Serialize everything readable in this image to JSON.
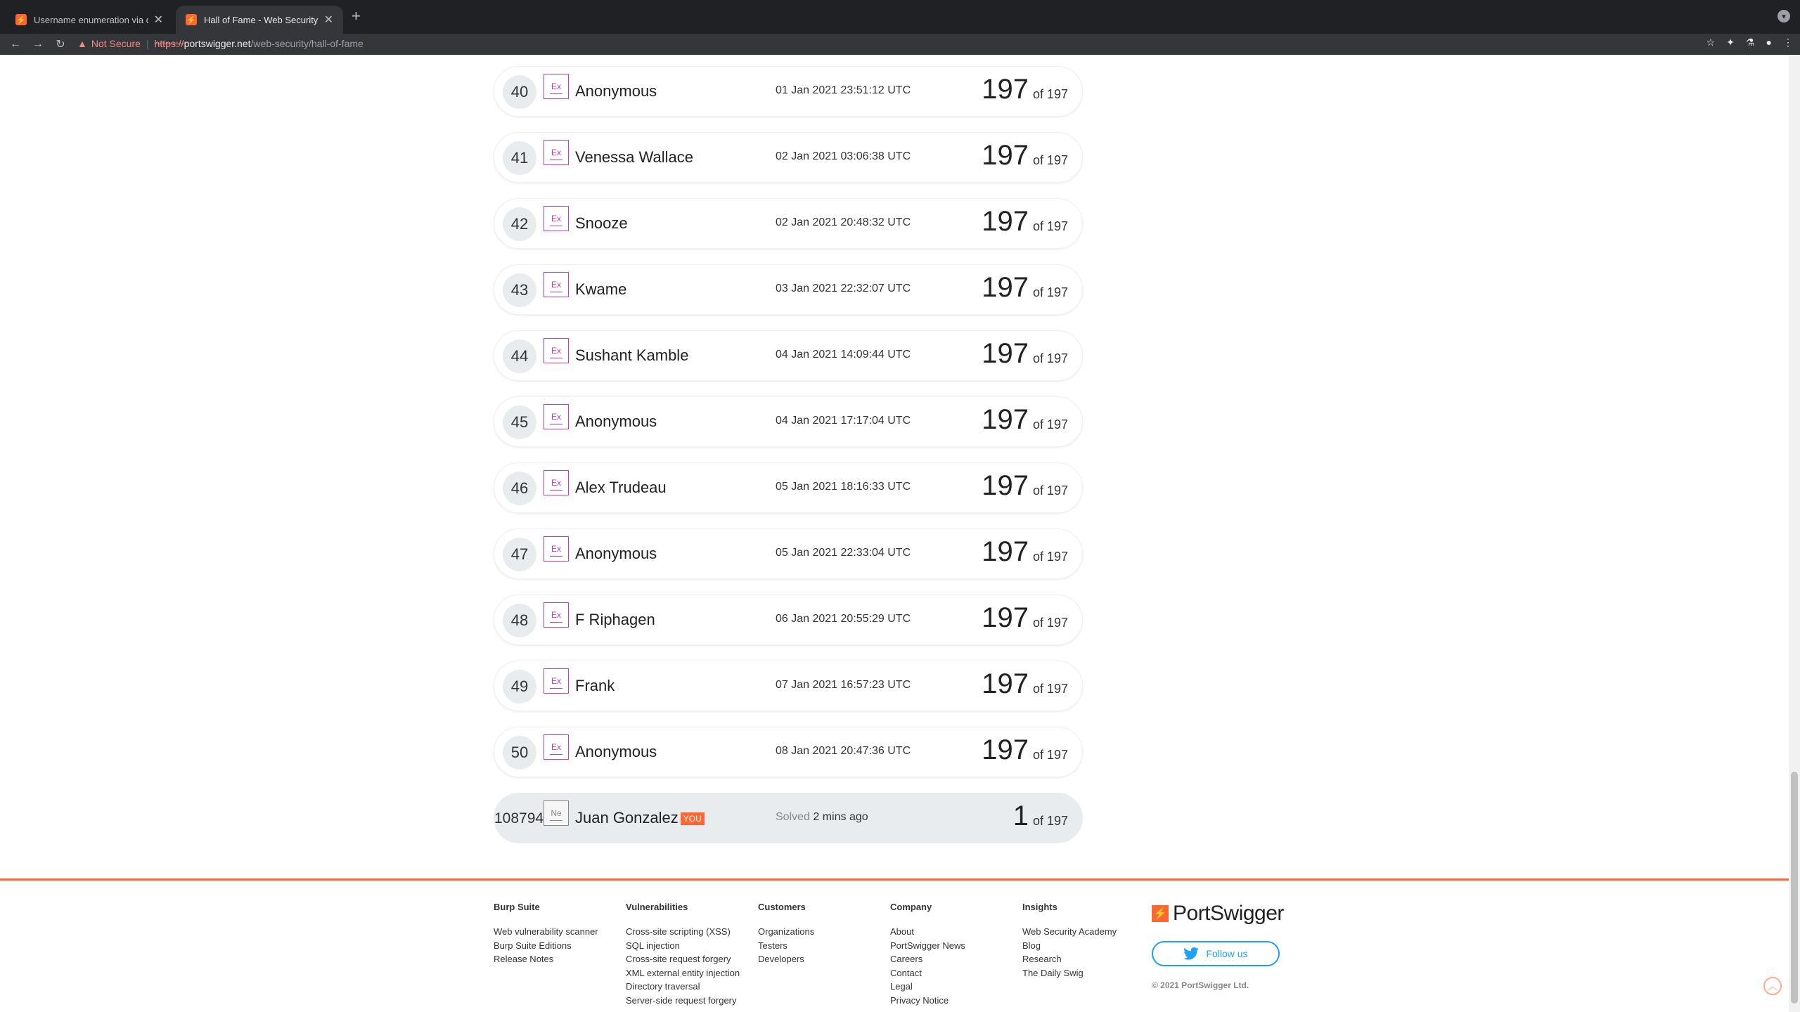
{
  "browser": {
    "tabs": [
      {
        "title": "Username enumeration via diff",
        "active": false
      },
      {
        "title": "Hall of Fame - Web Security Ac",
        "active": true
      }
    ],
    "security_label": "Not Secure",
    "url": {
      "scheme": "https://",
      "host": "portswigger.net",
      "path": "/web-security/hall-of-fame"
    }
  },
  "leaderboard": {
    "rows": [
      {
        "rank": "40",
        "badge": "Ex",
        "name": "Anonymous",
        "date": "01 Jan 2021 23:51:12 UTC",
        "score": "197",
        "of": "of 197"
      },
      {
        "rank": "41",
        "badge": "Ex",
        "name": "Venessa Wallace",
        "date": "02 Jan 2021 03:06:38 UTC",
        "score": "197",
        "of": "of 197"
      },
      {
        "rank": "42",
        "badge": "Ex",
        "name": "Snooze",
        "date": "02 Jan 2021 20:48:32 UTC",
        "score": "197",
        "of": "of 197"
      },
      {
        "rank": "43",
        "badge": "Ex",
        "name": "Kwame",
        "date": "03 Jan 2021 22:32:07 UTC",
        "score": "197",
        "of": "of 197"
      },
      {
        "rank": "44",
        "badge": "Ex",
        "name": "Sushant Kamble",
        "date": "04 Jan 2021 14:09:44 UTC",
        "score": "197",
        "of": "of 197"
      },
      {
        "rank": "45",
        "badge": "Ex",
        "name": "Anonymous",
        "date": "04 Jan 2021 17:17:04 UTC",
        "score": "197",
        "of": "of 197"
      },
      {
        "rank": "46",
        "badge": "Ex",
        "name": "Alex Trudeau",
        "date": "05 Jan 2021 18:16:33 UTC",
        "score": "197",
        "of": "of 197"
      },
      {
        "rank": "47",
        "badge": "Ex",
        "name": "Anonymous",
        "date": "05 Jan 2021 22:33:04 UTC",
        "score": "197",
        "of": "of 197"
      },
      {
        "rank": "48",
        "badge": "Ex",
        "name": "F Riphagen",
        "date": "06 Jan 2021 20:55:29 UTC",
        "score": "197",
        "of": "of 197"
      },
      {
        "rank": "49",
        "badge": "Ex",
        "name": "Frank",
        "date": "07 Jan 2021 16:57:23 UTC",
        "score": "197",
        "of": "of 197"
      },
      {
        "rank": "50",
        "badge": "Ex",
        "name": "Anonymous",
        "date": "08 Jan 2021 20:47:36 UTC",
        "score": "197",
        "of": "of 197"
      }
    ],
    "me": {
      "rank": "108794",
      "badge": "Ne",
      "name": "Juan Gonzalez",
      "you_label": "YOU",
      "solved_label": "Solved",
      "solved_value": "2 mins ago",
      "score": "1",
      "of": "of 197"
    }
  },
  "footer": {
    "columns": [
      {
        "heading": "Burp Suite",
        "links": [
          "Web vulnerability scanner",
          "Burp Suite Editions",
          "Release Notes"
        ]
      },
      {
        "heading": "Vulnerabilities",
        "links": [
          "Cross-site scripting (XSS)",
          "SQL injection",
          "Cross-site request forgery",
          "XML external entity injection",
          "Directory traversal",
          "Server-side request forgery"
        ]
      },
      {
        "heading": "Customers",
        "links": [
          "Organizations",
          "Testers",
          "Developers"
        ]
      },
      {
        "heading": "Company",
        "links": [
          "About",
          "PortSwigger News",
          "Careers",
          "Contact",
          "Legal",
          "Privacy Notice"
        ]
      },
      {
        "heading": "Insights",
        "links": [
          "Web Security Academy",
          "Blog",
          "Research",
          "The Daily Swig"
        ]
      }
    ],
    "brand": "PortSwigger",
    "follow": "Follow us",
    "copyright": "© 2021 PortSwigger Ltd."
  },
  "colors": {
    "accent": "#ff6633",
    "badge_expert": "#c23ab8",
    "twitter": "#1da1f2"
  }
}
